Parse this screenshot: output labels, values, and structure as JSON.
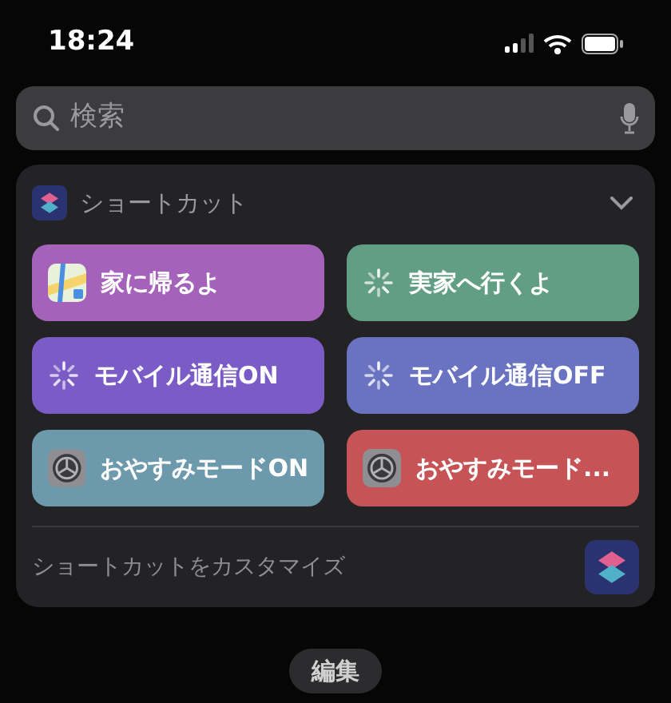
{
  "status_bar": {
    "time": "18:24"
  },
  "search": {
    "placeholder": "検索"
  },
  "widget": {
    "title": "ショートカット",
    "expanded": true,
    "shortcuts": [
      {
        "label": "家に帰るよ",
        "kind": "maps",
        "color": "#a562ba"
      },
      {
        "label": "実家へ行くよ",
        "kind": "spinner",
        "color": "#629e84"
      },
      {
        "label": "モバイル通信ON",
        "kind": "spinner",
        "color": "#7b5cc6"
      },
      {
        "label": "モバイル通信OFF",
        "kind": "spinner",
        "color": "#6a73c2"
      },
      {
        "label": "おやすみモードON",
        "kind": "settings",
        "color": "#6c99ab"
      },
      {
        "label": "おやすみモード...",
        "kind": "settings",
        "color": "#c65356"
      }
    ],
    "footer": "ショートカットをカスタマイズ"
  },
  "edit_button": "編集"
}
